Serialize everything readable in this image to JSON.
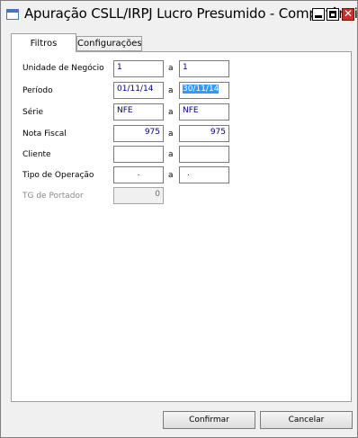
{
  "window": {
    "title": "Apuração CSLL/IRPJ Lucro Presumido - Competência"
  },
  "tabs": [
    {
      "label": "Filtros"
    },
    {
      "label": "Configurações"
    }
  ],
  "connector": "a",
  "fields": [
    {
      "label": "Unidade de Negócio",
      "from": "1",
      "to": "1"
    },
    {
      "label": "Período",
      "from": "01/11/14",
      "to": "30/11/14"
    },
    {
      "label": "Série",
      "from": "NFE",
      "to": "NFE"
    },
    {
      "label": "Nota Fiscal",
      "from": "975",
      "to": "975"
    },
    {
      "label": "Cliente",
      "from": "",
      "to": ""
    },
    {
      "label": "Tipo de Operação",
      "from": ".",
      "to": "."
    },
    {
      "label": "TG de Portador",
      "value": "0"
    }
  ],
  "buttons": {
    "confirm": "Confirmar",
    "cancel": "Cancelar"
  }
}
